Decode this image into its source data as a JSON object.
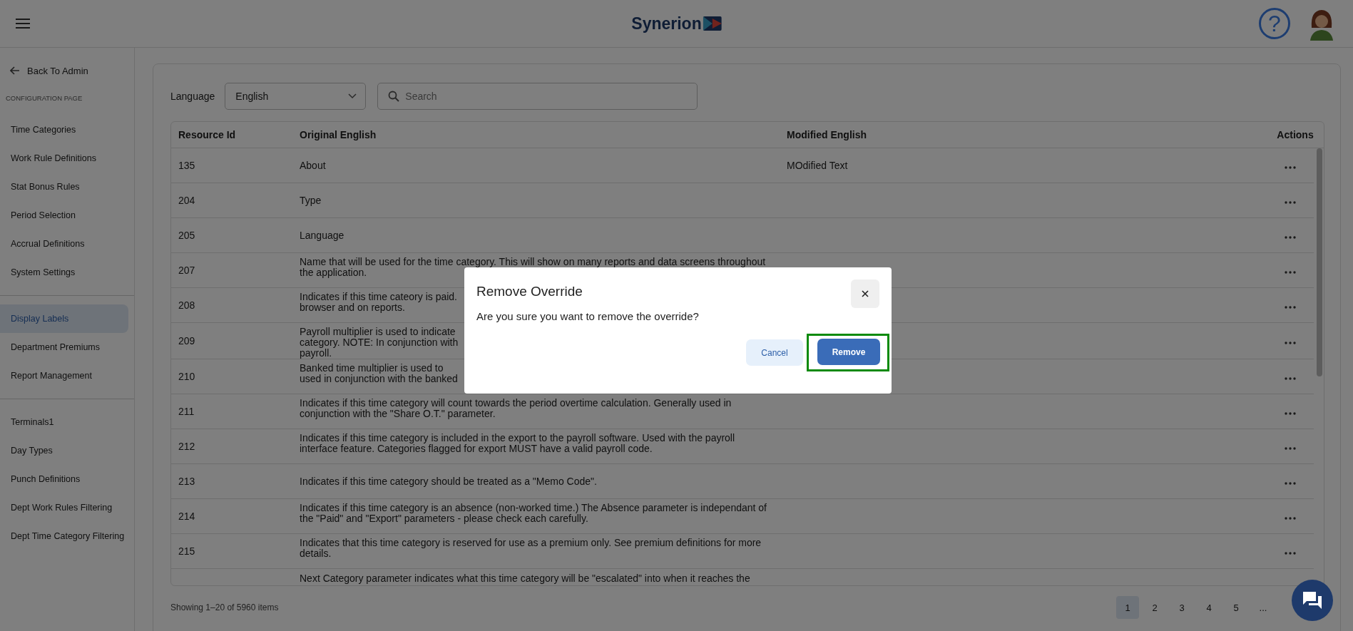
{
  "header": {
    "logo": "Synerion",
    "help": "?"
  },
  "sidebar": {
    "back": "Back To Admin",
    "section": "CONFIGURATION PAGE",
    "groups": [
      [
        {
          "label": "Time Categories",
          "selected": false
        },
        {
          "label": "Work Rule Definitions",
          "selected": false
        },
        {
          "label": "Stat Bonus Rules",
          "selected": false
        },
        {
          "label": "Period Selection",
          "selected": false
        },
        {
          "label": "Accrual Definitions",
          "selected": false
        },
        {
          "label": "System Settings",
          "selected": false
        }
      ],
      [
        {
          "label": "Display Labels",
          "selected": true
        },
        {
          "label": "Department Premiums",
          "selected": false
        },
        {
          "label": "Report Management",
          "selected": false
        }
      ],
      [
        {
          "label": "Terminals1",
          "selected": false
        },
        {
          "label": "Day Types",
          "selected": false
        },
        {
          "label": "Punch Definitions",
          "selected": false
        },
        {
          "label": "Dept Work Rules Filtering",
          "selected": false
        },
        {
          "label": "Dept Time Category Filtering",
          "selected": false
        }
      ]
    ]
  },
  "filters": {
    "language_label": "Language",
    "language": "English",
    "search_placeholder": "Search"
  },
  "table": {
    "columns": [
      "Resource Id",
      "Original English",
      "Modified English",
      "Actions"
    ],
    "rows": [
      {
        "id": "135",
        "original": "About",
        "modified": "MOdified Text"
      },
      {
        "id": "204",
        "original": "Type",
        "modified": ""
      },
      {
        "id": "205",
        "original": "Language",
        "modified": ""
      },
      {
        "id": "207",
        "original": "Name that will be used for the time category. This will show on many reports and data screens throughout\nthe application.",
        "modified": ""
      },
      {
        "id": "208",
        "original": "Indicates if this time cateory is paid.\nbrowser and on reports.",
        "modified": ""
      },
      {
        "id": "209",
        "original": "Payroll multiplier is used to indicate\ncategory. NOTE: In conjunction with\npayroll.",
        "modified": ""
      },
      {
        "id": "210",
        "original": "Banked time multiplier is used to\nused in conjunction with the banked",
        "modified": ""
      },
      {
        "id": "211",
        "original": "Indicates if this time category will count towards the period overtime calculation. Generally used in\nconjunction with the \"Share O.T.\" parameter.",
        "modified": ""
      },
      {
        "id": "212",
        "original": "Indicates if this time category is included in the export to the payroll software. Used with the payroll\ninterface feature. Categories flagged for export MUST have a valid payroll code.",
        "modified": ""
      },
      {
        "id": "213",
        "original": "Indicates if this time category should be treated as a \"Memo Code\".",
        "modified": ""
      },
      {
        "id": "214",
        "original": "Indicates if this time category is an absence (non-worked time.) The Absence parameter is independant of\nthe \"Paid\" and \"Export\" parameters - please check each carefully.",
        "modified": ""
      },
      {
        "id": "215",
        "original": "Indicates that this time category is reserved for use as a premium only. See premium definitions for more\ndetails.",
        "modified": ""
      },
      {
        "id": "",
        "original": "Next Category parameter indicates what this time category will be \"escalated\" into when it reaches the",
        "modified": ""
      }
    ]
  },
  "footer": {
    "summary": "Showing 1–20 of 5960 items",
    "pages": [
      {
        "label": "1",
        "selected": true
      },
      {
        "label": "2",
        "selected": false
      },
      {
        "label": "3",
        "selected": false
      },
      {
        "label": "4",
        "selected": false
      },
      {
        "label": "5",
        "selected": false
      },
      {
        "label": "...",
        "selected": false
      }
    ]
  },
  "dialog": {
    "title": "Remove Override",
    "message": "Are you sure you want to remove the override?",
    "cancel": "Cancel",
    "confirm": "Remove",
    "confirm_highlighted": true
  }
}
